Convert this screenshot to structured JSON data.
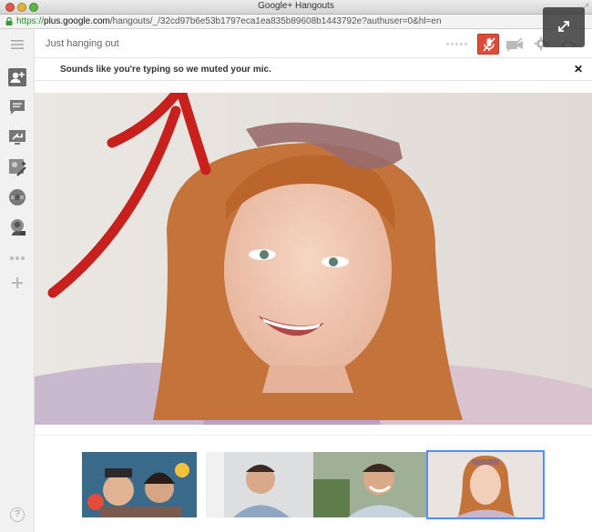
{
  "window": {
    "title": "Google+ Hangouts",
    "url_scheme": "https://",
    "url_host": "plus.google.com",
    "url_path": "/hangouts/_/32cd97b6e53b1797eca1ea835b89608b1443792e?authuser=0&hl=en"
  },
  "topbar": {
    "topic": "Just hanging out"
  },
  "notification": {
    "message": "Sounds like you're typing so we muted your mic.",
    "close_label": "✕"
  },
  "sidebar": {
    "items": [
      {
        "name": "invite-people",
        "icon": "person-add-icon"
      },
      {
        "name": "chat",
        "icon": "chat-icon"
      },
      {
        "name": "screenshare",
        "icon": "screenshare-icon"
      },
      {
        "name": "google-effects",
        "icon": "effects-icon"
      },
      {
        "name": "capture",
        "icon": "capture-icon"
      },
      {
        "name": "cameraman",
        "icon": "cameraman-icon"
      },
      {
        "name": "more-apps",
        "icon": "more-dots-icon"
      },
      {
        "name": "add-apps",
        "icon": "plus-icon"
      }
    ],
    "help_label": "?"
  },
  "colors": {
    "mic_muted": "#dd4b39",
    "selected_outline": "#4d90fe"
  }
}
